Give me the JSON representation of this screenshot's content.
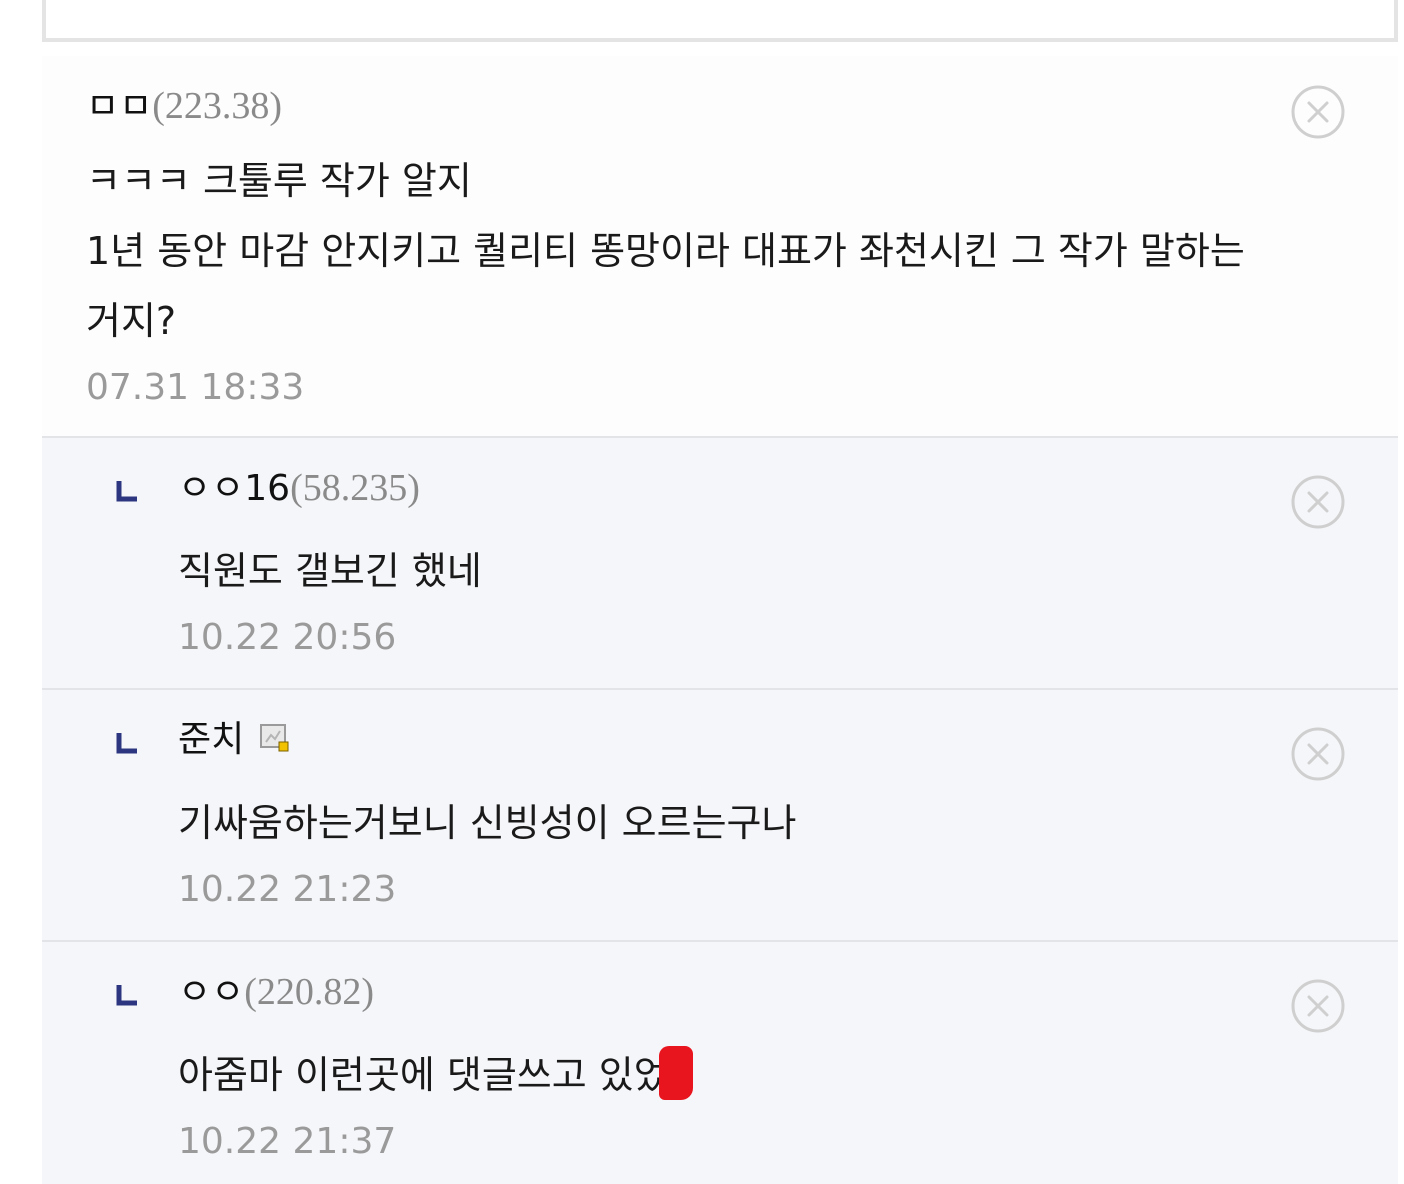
{
  "comments": [
    {
      "nickname": "ㅁㅁ",
      "ip": "(223.38)",
      "body": "ㅋㅋㅋ 크툴루 작가 알지\n1년 동안 마감 안지키고 퀄리티 똥망이라 대표가 좌천시킨 그 작가 말하는 거지?",
      "time": "07.31 18:33"
    }
  ],
  "replies": [
    {
      "nickname": "ㅇㅇ16",
      "ip": "(58.235)",
      "body": "직원도 갤보긴 했네",
      "time": "10.22 20:56"
    },
    {
      "nickname": "준치",
      "ip": "",
      "badge_icon": "fixed-nickname-icon",
      "body": "기싸움하는거보니 신빙성이 오르는구나",
      "time": "10.22 21:23"
    },
    {
      "nickname": "ㅇㅇ",
      "ip": "(220.82)",
      "body": "아줌마 이런곳에 댓글쓰고 있었",
      "time": "10.22 21:37"
    }
  ],
  "icons": {
    "reply_arrow": "reply-arrow-icon",
    "delete": "close-circle-icon"
  },
  "colors": {
    "reply_arrow": "#2b3580",
    "redaction": "#e8141e",
    "reply_background": "#f5f6f9"
  }
}
